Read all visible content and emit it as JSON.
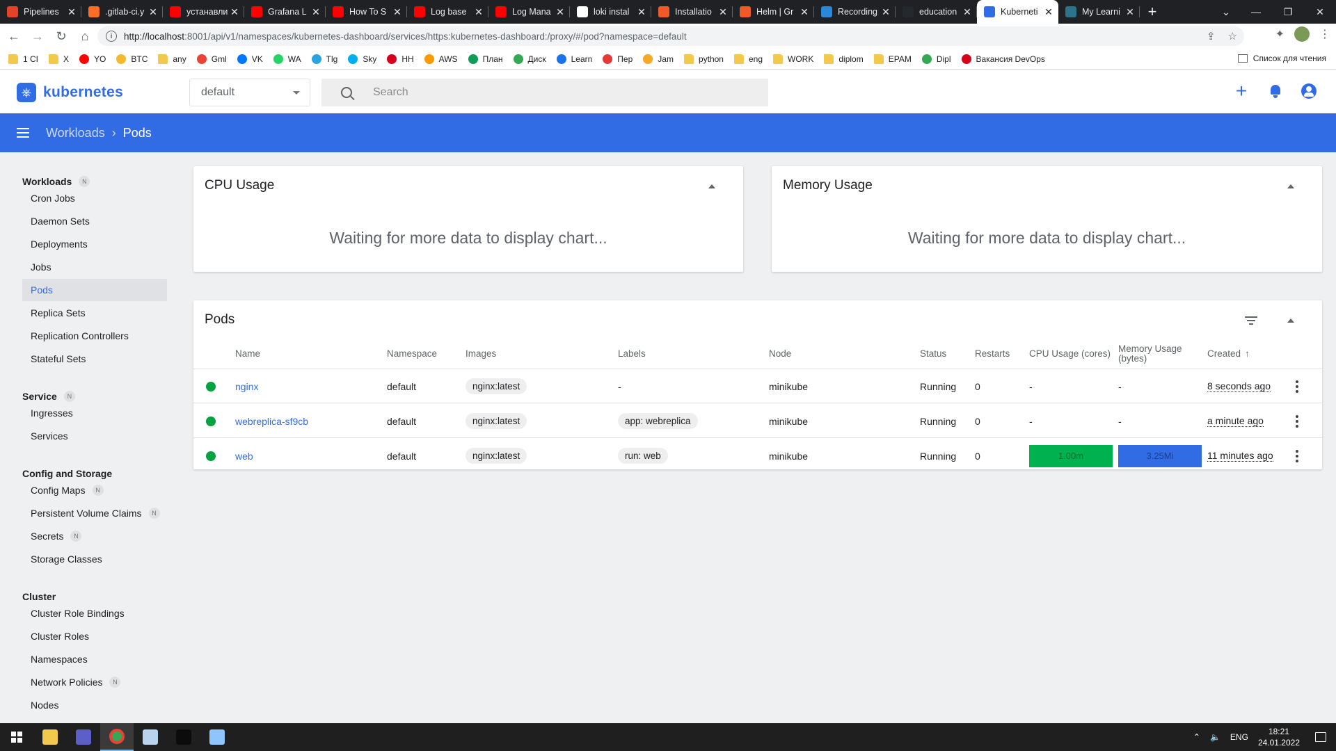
{
  "browser": {
    "tabs": [
      {
        "title": "Pipelines",
        "fav": "#e24329"
      },
      {
        "title": ".gitlab-ci.y",
        "fav": "#fc6d26"
      },
      {
        "title": "устанавли",
        "fav": "#ff0000"
      },
      {
        "title": "Grafana L",
        "fav": "#ff0000"
      },
      {
        "title": "How To S",
        "fav": "#ff0000"
      },
      {
        "title": "Log base",
        "fav": "#ff0000"
      },
      {
        "title": "Log Mana",
        "fav": "#ff0000"
      },
      {
        "title": "loki instal",
        "fav": "#ffffff"
      },
      {
        "title": "Installatio",
        "fav": "#f05a28"
      },
      {
        "title": "Helm | Gr",
        "fav": "#f05a28"
      },
      {
        "title": "Recording",
        "fav": "#2b88d8"
      },
      {
        "title": "education",
        "fav": "#24292e"
      },
      {
        "title": "Kuberneti",
        "fav": "#326ce5",
        "active": true
      },
      {
        "title": "My Learni",
        "fav": "#2b7489"
      }
    ],
    "url_host": "http://localhost",
    "url_rest": ":8001/api/v1/namespaces/kubernetes-dashboard/services/https:kubernetes-dashboard:/proxy/#/pod?namespace=default",
    "bookmarks": [
      {
        "label": "1 CI",
        "color": "folder"
      },
      {
        "label": "X",
        "color": "folder"
      },
      {
        "label": "YO",
        "color": "#ff0000"
      },
      {
        "label": "BTC",
        "color": "#f3ba2f"
      },
      {
        "label": "any",
        "color": "folder"
      },
      {
        "label": "Gml",
        "color": "#ea4335"
      },
      {
        "label": "VK",
        "color": "#0077ff"
      },
      {
        "label": "WA",
        "color": "#25d366"
      },
      {
        "label": "Tlg",
        "color": "#2aa3df"
      },
      {
        "label": "Sky",
        "color": "#00aff0"
      },
      {
        "label": "HH",
        "color": "#d6001c"
      },
      {
        "label": "AWS",
        "color": "#ff9900"
      },
      {
        "label": "План",
        "color": "#0f9d58"
      },
      {
        "label": "Диск",
        "color": "#34a853"
      },
      {
        "label": "Learn",
        "color": "#1a73e8"
      },
      {
        "label": "Пер",
        "color": "#e53935"
      },
      {
        "label": "Jam",
        "color": "#f9a825"
      },
      {
        "label": "python",
        "color": "folder"
      },
      {
        "label": "eng",
        "color": "folder"
      },
      {
        "label": "WORK",
        "color": "folder"
      },
      {
        "label": "diplom",
        "color": "folder"
      },
      {
        "label": "EPAM",
        "color": "folder"
      },
      {
        "label": "Dipl",
        "color": "#34a853"
      },
      {
        "label": "Вакансия DevOps",
        "color": "#d6001c"
      }
    ],
    "reading_list": "Список для чтения"
  },
  "app": {
    "brand": "kubernetes",
    "namespace": "default",
    "search_placeholder": "Search",
    "breadcrumb": {
      "parent": "Workloads",
      "current": "Pods"
    }
  },
  "sidebar": {
    "workloads": "Workloads",
    "service": "Service",
    "config": "Config and Storage",
    "cluster": "Cluster",
    "badge": "N",
    "workload_items": [
      "Cron Jobs",
      "Daemon Sets",
      "Deployments",
      "Jobs",
      "Pods",
      "Replica Sets",
      "Replication Controllers",
      "Stateful Sets"
    ],
    "service_items": [
      "Ingresses",
      "Services"
    ],
    "config_items": [
      "Config Maps",
      "Persistent Volume Claims",
      "Secrets",
      "Storage Classes"
    ],
    "cluster_items": [
      "Cluster Role Bindings",
      "Cluster Roles",
      "Namespaces",
      "Network Policies",
      "Nodes"
    ]
  },
  "cpu_card": {
    "title": "CPU Usage",
    "message": "Waiting for more data to display chart..."
  },
  "mem_card": {
    "title": "Memory Usage",
    "message": "Waiting for more data to display chart..."
  },
  "pods": {
    "title": "Pods",
    "headers": {
      "name": "Name",
      "namespace": "Namespace",
      "images": "Images",
      "labels": "Labels",
      "node": "Node",
      "status": "Status",
      "restarts": "Restarts",
      "cpu": "CPU Usage (cores)",
      "mem_line1": "Memory Usage",
      "mem_line2": "(bytes)",
      "created": "Created",
      "sort_arrow": "↑"
    },
    "rows": [
      {
        "name": "nginx",
        "namespace": "default",
        "image": "nginx:latest",
        "label": "-",
        "node": "minikube",
        "status": "Running",
        "restarts": "0",
        "cpu": "-",
        "mem": "-",
        "created": "8 seconds ago"
      },
      {
        "name": "webreplica-sf9cb",
        "namespace": "default",
        "image": "nginx:latest",
        "label": "app: webreplica",
        "node": "minikube",
        "status": "Running",
        "restarts": "0",
        "cpu": "-",
        "mem": "-",
        "created": "a minute ago"
      },
      {
        "name": "web",
        "namespace": "default",
        "image": "nginx:latest",
        "label": "run: web",
        "node": "minikube",
        "status": "Running",
        "restarts": "0",
        "cpu": "1.00m",
        "mem": "3.25Mi",
        "created": "11 minutes ago"
      }
    ]
  },
  "taskbar": {
    "lang": "ENG",
    "time": "18:21",
    "date": "24.01.2022",
    "apps": [
      {
        "name": "file-explorer",
        "color": "#f2c94c"
      },
      {
        "name": "teams",
        "color": "#5b5fc7"
      },
      {
        "name": "chrome",
        "color": "#34a853",
        "active": true
      },
      {
        "name": "virtualbox",
        "color": "#b9d3ee"
      },
      {
        "name": "terminal",
        "color": "#0c0c0c"
      },
      {
        "name": "paint",
        "color": "#8ec5fc"
      }
    ]
  }
}
